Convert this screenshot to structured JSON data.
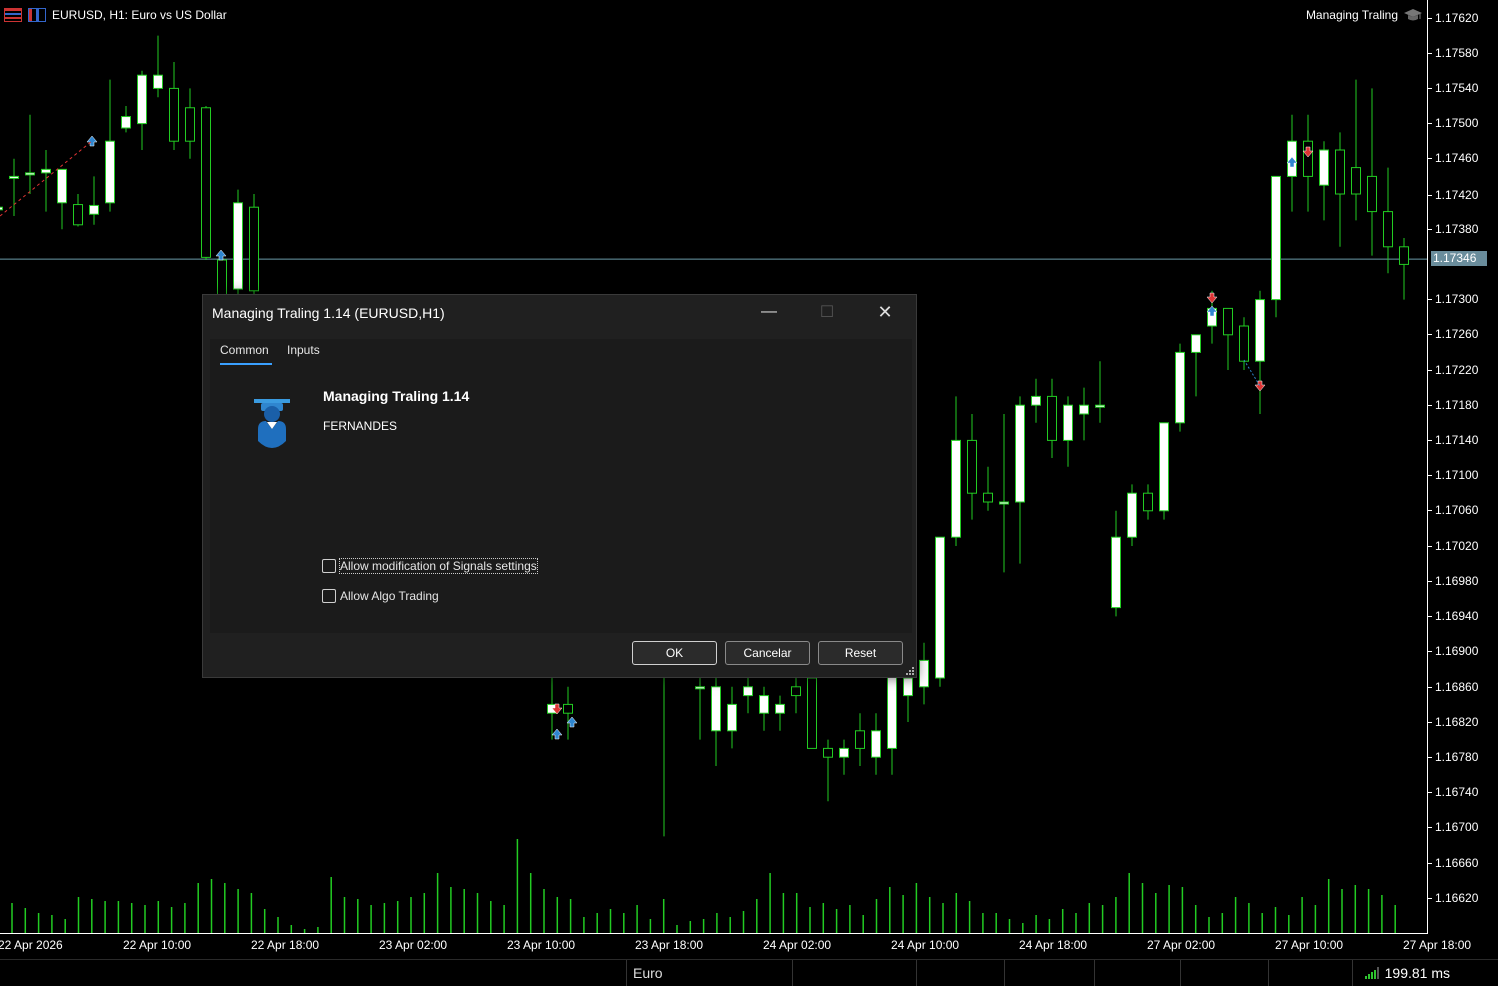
{
  "window": {
    "symbol_title": "EURUSD, H1:  Euro vs US Dollar",
    "ea_label": "Managing Traling",
    "ea_label_icon": "graduation-cap-icon"
  },
  "price_axis": {
    "labels": [
      "1.17620",
      "1.17580",
      "1.17540",
      "1.17500",
      "1.17460",
      "1.17420",
      "1.17380",
      "1.17300",
      "1.17260",
      "1.17220",
      "1.17180",
      "1.17140",
      "1.17100",
      "1.17060",
      "1.17020",
      "1.16980",
      "1.16940",
      "1.16900",
      "1.16860",
      "1.16820",
      "1.16780",
      "1.16740",
      "1.16700",
      "1.16660",
      "1.16620"
    ],
    "current_price": "1.17346"
  },
  "time_axis": {
    "labels": [
      "22 Apr 2026",
      "22 Apr 10:00",
      "22 Apr 18:00",
      "23 Apr 02:00",
      "23 Apr 10:00",
      "23 Apr 18:00",
      "24 Apr 02:00",
      "24 Apr 10:00",
      "24 Apr 18:00",
      "27 Apr 02:00",
      "27 Apr 10:00",
      "27 Apr 18:00"
    ]
  },
  "status_bar": {
    "profile": "Euro",
    "ping": "199.81 ms"
  },
  "colors": {
    "bull_body": "#ffffff",
    "wick": "#22cc22",
    "volume": "#22cc22",
    "price_line": "#6a9aa8",
    "accent": "#3aa0ff"
  },
  "dialog": {
    "title": "Managing Traling 1.14 (EURUSD,H1)",
    "minimize": "—",
    "maximize": "☐",
    "close": "✕",
    "tabs": [
      {
        "label": "Common"
      },
      {
        "label": "Inputs"
      }
    ],
    "ea_icon": "graduate-icon",
    "ea_name": "Managing Traling 1.14",
    "ea_author": "FERNANDES",
    "checkboxes": [
      {
        "label": "Allow modification of Signals settings",
        "checked": false
      },
      {
        "label": "Allow Algo Trading",
        "checked": false
      }
    ],
    "buttons": {
      "ok": "OK",
      "cancel": "Cancelar",
      "reset": "Reset"
    }
  },
  "chart_data": {
    "type": "candlestick",
    "symbol": "EURUSD",
    "timeframe": "H1",
    "ylim": [
      1.166,
      1.1764
    ],
    "current_price": 1.17346,
    "candles": [
      {
        "o": 1.17402,
        "h": 1.1744,
        "l": 1.17395,
        "c": 1.17405
      },
      {
        "o": 1.1744,
        "h": 1.1746,
        "l": 1.17395,
        "c": 1.1744
      },
      {
        "o": 1.17442,
        "h": 1.1751,
        "l": 1.1742,
        "c": 1.17444
      },
      {
        "o": 1.17444,
        "h": 1.1747,
        "l": 1.174,
        "c": 1.17448
      },
      {
        "o": 1.1741,
        "h": 1.1743,
        "l": 1.1738,
        "c": 1.17448
      },
      {
        "o": 1.17408,
        "h": 1.1742,
        "l": 1.17383,
        "c": 1.17385
      },
      {
        "o": 1.17397,
        "h": 1.1744,
        "l": 1.17385,
        "c": 1.17407
      },
      {
        "o": 1.1741,
        "h": 1.1755,
        "l": 1.174,
        "c": 1.1748
      },
      {
        "o": 1.17495,
        "h": 1.1752,
        "l": 1.1749,
        "c": 1.17508
      },
      {
        "o": 1.175,
        "h": 1.1756,
        "l": 1.1747,
        "c": 1.17555
      },
      {
        "o": 1.1754,
        "h": 1.176,
        "l": 1.1753,
        "c": 1.17555
      },
      {
        "o": 1.1754,
        "h": 1.1757,
        "l": 1.1747,
        "c": 1.1748
      },
      {
        "o": 1.17518,
        "h": 1.1754,
        "l": 1.1746,
        "c": 1.1748
      },
      {
        "o": 1.17518,
        "h": 1.1752,
        "l": 1.17345,
        "c": 1.17348
      },
      {
        "o": 1.17345,
        "h": 1.1735,
        "l": 1.173,
        "c": 1.17305
      },
      {
        "o": 1.17312,
        "h": 1.17425,
        "l": 1.173,
        "c": 1.1741
      },
      {
        "o": 1.17405,
        "h": 1.1742,
        "l": 1.173,
        "c": 1.1731
      }
    ],
    "volume_description": "tick volume histogram at bottom of chart"
  }
}
